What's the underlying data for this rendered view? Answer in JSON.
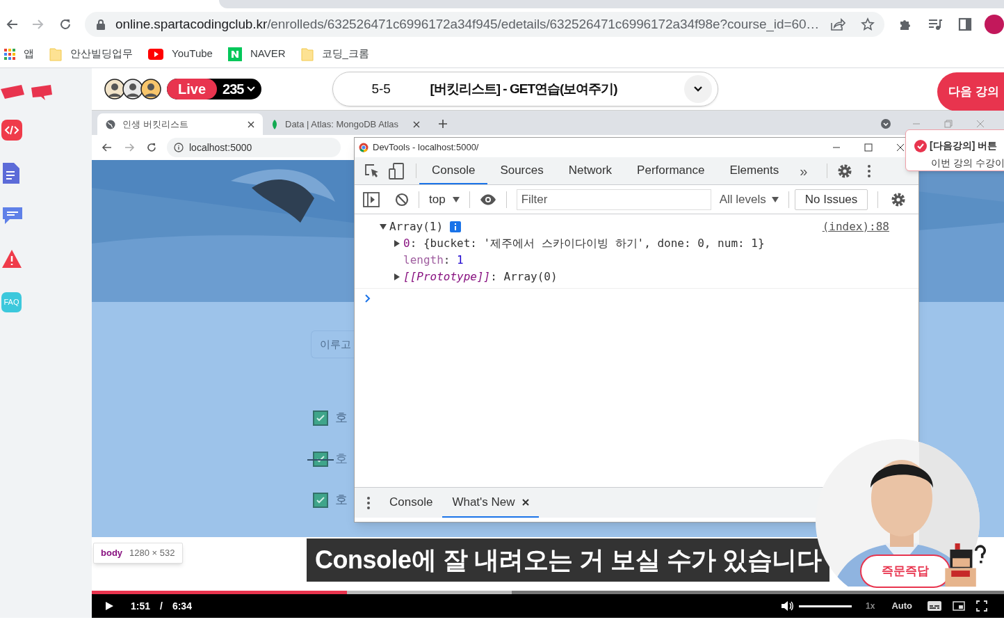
{
  "browser": {
    "address_host": "online.spartacodingclub.kr",
    "address_path": "/enrolleds/632526471c6996172a34f945/edetails/632526471c6996172a34f98e?course_id=60…",
    "bookmarks": [
      {
        "label": "앱",
        "kind": "apps"
      },
      {
        "label": "안산빌딩업무",
        "kind": "folder"
      },
      {
        "label": "YouTube",
        "kind": "youtube"
      },
      {
        "label": "NAVER",
        "kind": "naver"
      },
      {
        "label": "코딩_크롬",
        "kind": "folder"
      }
    ]
  },
  "sidebar": {
    "items": [
      {
        "kind": "code"
      },
      {
        "kind": "notes"
      },
      {
        "kind": "chat"
      },
      {
        "kind": "alert"
      },
      {
        "kind": "faq",
        "label": "FAQ"
      }
    ]
  },
  "header": {
    "live_label": "Live",
    "viewer_count": "235",
    "lesson_number": "5-5",
    "lesson_title": "[버킷리스트] - GET연습(보여주기)",
    "next_button": "다음 강의"
  },
  "toast": {
    "title": "[다음강의] 버튼",
    "line_2": "이번 강의 수강이"
  },
  "video": {
    "tabs": [
      {
        "label": "인생 버킷리스트",
        "selected": true
      },
      {
        "label": "Data | Atlas: MongoDB Atlas",
        "selected": false
      }
    ],
    "address": "localhost:5000",
    "input_placeholder": "이루고",
    "list_items": [
      {
        "label": "호",
        "checked": true,
        "done": false
      },
      {
        "label": "호",
        "checked": true,
        "done": true
      },
      {
        "label": "호",
        "checked": true,
        "done": false
      }
    ],
    "element_hint": {
      "tag": "body",
      "size": "1280 × 532"
    },
    "caption": "Console에 잘 내려오는 거 보실 수가 있습니다",
    "qa_button": "즉문즉답",
    "player": {
      "level": 0.28,
      "buffer": {
        "level": 0.46
      },
      "current": "1:51",
      "separator": "/",
      "duration": "6:34",
      "volume": {
        "level": 1
      },
      "speed": "1x",
      "quality": "Auto"
    }
  },
  "devtools": {
    "title": "DevTools - localhost:5000/",
    "tabs": [
      {
        "label": "Console",
        "selected": true
      },
      {
        "label": "Sources",
        "selected": false
      },
      {
        "label": "Network",
        "selected": false
      },
      {
        "label": "Performance",
        "selected": false
      },
      {
        "label": "Elements",
        "selected": false
      }
    ],
    "more": "»",
    "context": "top",
    "filter_placeholder": "Filter",
    "levels": "All levels",
    "issues": "No Issues",
    "log": {
      "label": "Array(1)",
      "expanded": true,
      "source": "(index):88",
      "entries": [
        {
          "key": "0",
          "punct": ":",
          "kind": "object",
          "expanded": false,
          "value": "{bucket: '제주에서 스카이다이빙 하기', done: 0, num: 1}"
        },
        {
          "key": "length",
          "punct": ":",
          "kind": "number",
          "value": "1"
        },
        {
          "key": "[[Prototype]]",
          "punct": ":",
          "kind": "proto",
          "expanded": false,
          "value": "Array(0)"
        }
      ]
    },
    "drawer_tabs": [
      {
        "label": "Console",
        "selected": false,
        "closable": false
      },
      {
        "label": "What's New",
        "selected": true,
        "closable": true
      }
    ]
  }
}
